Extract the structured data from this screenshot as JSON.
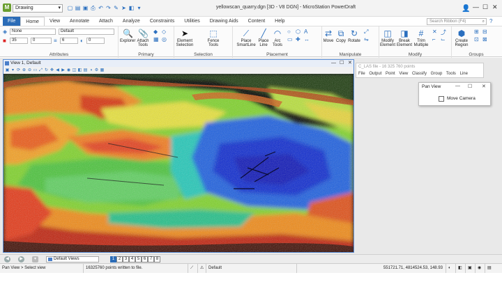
{
  "titlebar": {
    "workspace": "Drawing",
    "title": "yellowscan_quarry.dgn [3D - V8 DGN] - MicroStation PowerDraft",
    "minimize": "—",
    "maximize": "☐",
    "close": "✕"
  },
  "tabs": [
    "File",
    "Home",
    "View",
    "Annotate",
    "Attach",
    "Analyze",
    "Constraints",
    "Utilities",
    "Drawing Aids",
    "Content",
    "Help"
  ],
  "active_tab": "Home",
  "search": {
    "placeholder": "Search Ribbon (F4)"
  },
  "ribbon": {
    "attributes": {
      "label": "Attributes",
      "level": "None",
      "style": "Default",
      "color": "35",
      "line_style": "0",
      "weight": "6",
      "transparency": "0"
    },
    "primary": {
      "label": "Primary",
      "explorer": "Explorer",
      "attach_tools": "Attach Tools"
    },
    "selection": {
      "label": "Selection",
      "element_selection": "Element Selection",
      "fence_tools": "Fence Tools"
    },
    "placement": {
      "label": "Placement",
      "place_smartline": "Place SmartLine",
      "place_line": "Place Line",
      "arc_tools": "Arc Tools"
    },
    "manipulate": {
      "label": "Manipulate",
      "move": "Move",
      "copy": "Copy",
      "rotate": "Rotate"
    },
    "modify": {
      "label": "Modify",
      "modify_element": "Modify Element",
      "break_element": "Break Element",
      "trim_multiple": "Trim Multiple"
    },
    "groups": {
      "label": "Groups",
      "create_region": "Create Region"
    }
  },
  "view": {
    "title": "View 1, Default"
  },
  "cloud_panel": {
    "title": "C_LAS file - 16 325 760 points",
    "menu": [
      "File",
      "Output",
      "Point",
      "View",
      "Classify",
      "Group",
      "Tools",
      "Line"
    ]
  },
  "pan_dialog": {
    "title": "Pan View",
    "checkbox_label": "Move Camera",
    "checked": false
  },
  "viewbar": {
    "view_group": "Default Views",
    "views": [
      "1",
      "2",
      "3",
      "4",
      "5",
      "6",
      "7",
      "8"
    ],
    "active_view": "1"
  },
  "statusbar": {
    "prompt": "Pan View > Select view",
    "message": "16325760 points written to file.",
    "model": "Default",
    "coordinates": "551721.71, 4814524.53, 148.93"
  }
}
